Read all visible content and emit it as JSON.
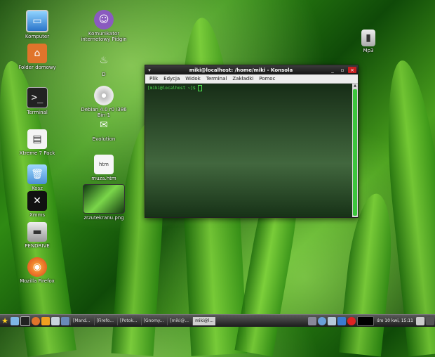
{
  "desktop": {
    "icons": [
      {
        "label": "Komputer"
      },
      {
        "label": "Folder domowy"
      },
      {
        "label": "Terminal"
      },
      {
        "label": "Xtreme 7 Pack"
      },
      {
        "label": "Kosz"
      },
      {
        "label": "Xmms"
      },
      {
        "label": "PENDRIVE"
      },
      {
        "label": "Mozilla Firefox"
      },
      {
        "label": "Komunikator internetowy Pidgin"
      },
      {
        "label": "D"
      },
      {
        "label": "Debian 4.0 r0 i386 Bin-1"
      },
      {
        "label": "Evolution"
      },
      {
        "label": "muza.htm"
      },
      {
        "label": "zrzutekranu.png"
      },
      {
        "label": "Mp3"
      }
    ]
  },
  "konsole": {
    "title": "miki@localhost: /home/miki - Konsola",
    "menu": [
      "Plik",
      "Edycja",
      "Widok",
      "Terminal",
      "Zakładki",
      "Pomoc"
    ],
    "prompt": "[miki@localhost ~]$ "
  },
  "taskbar": {
    "tasks": [
      {
        "label": "[Mand..."
      },
      {
        "label": "[Firefo..."
      },
      {
        "label": "[Potok..."
      },
      {
        "label": "[Gnomy..."
      },
      {
        "label": "[miki@..."
      },
      {
        "label": "miki@l..."
      }
    ],
    "clock": "śro 10 kwi, 15:11"
  }
}
